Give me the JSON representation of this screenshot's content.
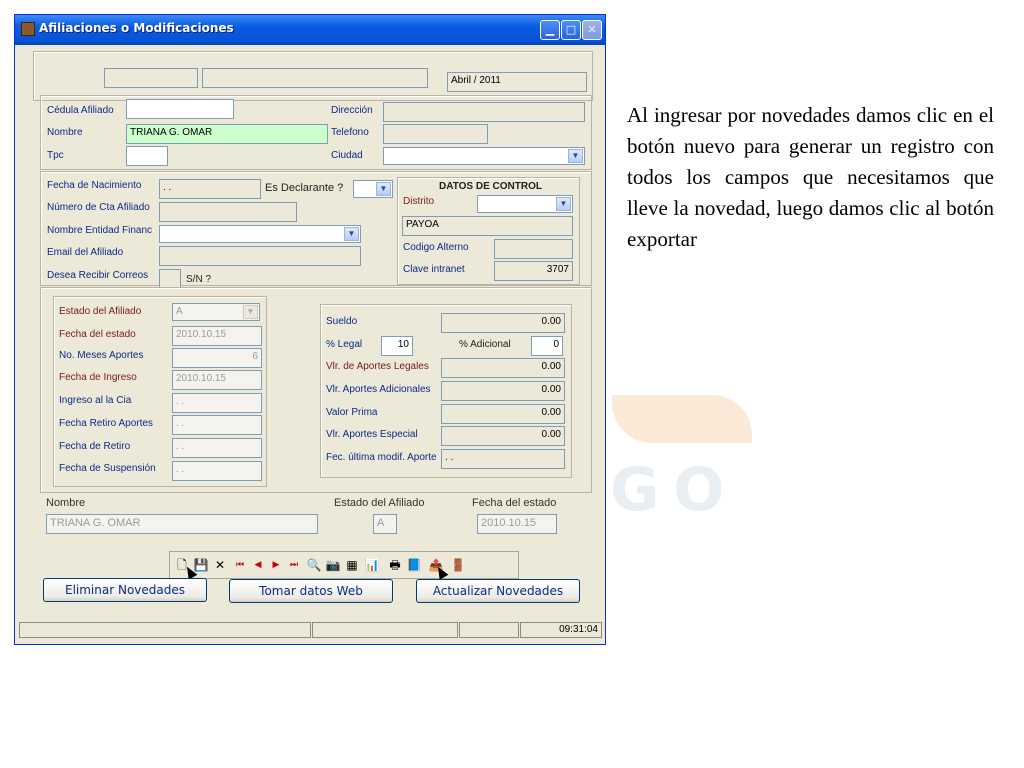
{
  "window": {
    "title": "Afiliaciones o Modificaciones",
    "top_date": "Abril / 2011",
    "top_fields": [
      "",
      ""
    ]
  },
  "section1": {
    "cedula_label": "Cédula Afiliado",
    "cedula_value": "",
    "nombre_label": "Nombre",
    "nombre_value": "TRIANA G. OMAR",
    "tpc_label": "Tpc",
    "tpc_value": "",
    "direccion_label": "Dirección",
    "direccion_value": "",
    "telefono_label": "Telefono",
    "telefono_value": "",
    "ciudad_label": "Ciudad",
    "ciudad_value": ""
  },
  "section2": {
    "nacimiento_label": "Fecha de Nacimiento",
    "nacimiento_value": ". .",
    "declarante_label": "Es Declarante ?",
    "cta_label": "Número de Cta Afiliado",
    "entidad_label": "Nombre Entidad Financ",
    "email_label": "Email del Afiliado",
    "correos_label": "Desea  Recibir Correos",
    "sn_label": "S/N ?",
    "control_title": "DATOS DE CONTROL",
    "distrito_label": "Distrito",
    "distrito_value": "PAYOA",
    "codigo_label": "Codigo Alterno",
    "clave_label": "Clave intranet",
    "clave_value": "3707"
  },
  "estado": {
    "estado_label": "Estado del Afiliado",
    "estado_value": "A",
    "fecha_estado_label": "Fecha del estado",
    "fecha_estado_value": "2010.10.15",
    "meses_label": "No. Meses Aportes",
    "meses_value": "6",
    "ingreso_label": "Fecha de Ingreso",
    "ingreso_value": "2010.10.15",
    "ingreso_cia_label": "Ingreso al la Cia",
    "ingreso_cia_value": ". .",
    "retiro_aportes_label": "Fecha Retiro Aportes",
    "retiro_aportes_value": ". .",
    "retiro_label": "Fecha de Retiro",
    "retiro_value": ". .",
    "suspension_label": "Fecha de Suspensión",
    "suspension_value": ". ."
  },
  "aportes": {
    "sueldo_label": "Sueldo",
    "sueldo_value": "0.00",
    "legal_label": "% Legal",
    "legal_value": "10",
    "adicional_label": "% Adicional",
    "adicional_value": "0",
    "aportes_legales_label": "Vlr. de Aportes Legales",
    "aportes_legales_value": "0.00",
    "aportes_adicionales_label": "Vlr. Aportes Adicionales",
    "aportes_adicionales_value": "0.00",
    "valor_prima_label": "Valor Prima",
    "valor_prima_value": "0.00",
    "aportes_especial_label": "Vlr. Aportes Especial",
    "aportes_especial_value": "0.00",
    "ultima_modif_label": "Fec. última modif. Aporte",
    "ultima_modif_value": ". ."
  },
  "summary": {
    "nombre_label": "Nombre",
    "nombre_value": "TRIANA G. OMAR",
    "estado_label": "Estado del Afiliado",
    "estado_value": "A",
    "fecha_label": "Fecha del estado",
    "fecha_value": "2010.10.15"
  },
  "buttons": {
    "eliminar": "Eliminar Novedades",
    "tomar": "Tomar datos Web",
    "actualizar": "Actualizar Novedades"
  },
  "status": {
    "time": "09:31:04"
  },
  "description": "Al ingresar por novedades damos clic en el botón nuevo para generar un registro con todos los campos que necesitamos que lleve la novedad, luego damos clic al botón exportar"
}
